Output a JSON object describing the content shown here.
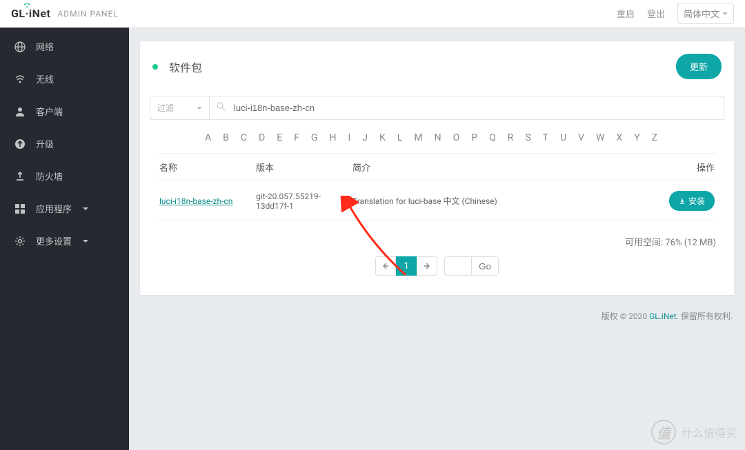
{
  "header": {
    "brand_prefix": "GL",
    "brand_suffix": "iNet",
    "panel_label": "ADMIN PANEL",
    "reboot": "重启",
    "logout": "登出",
    "lang": "简体中文"
  },
  "sidebar": {
    "items": [
      {
        "icon": "globe",
        "label": "网络"
      },
      {
        "icon": "wifi",
        "label": "无线"
      },
      {
        "icon": "user",
        "label": "客户端"
      },
      {
        "icon": "arrow-up-circle",
        "label": "升级"
      },
      {
        "icon": "upload",
        "label": "防火墙"
      },
      {
        "icon": "grid",
        "label": "应用程序",
        "dropdown": true
      },
      {
        "icon": "gear",
        "label": "更多设置",
        "dropdown": true
      }
    ]
  },
  "page": {
    "title": "软件包",
    "update_btn": "更新",
    "filter_placeholder": "过滤",
    "search_value": "luci-i18n-base-zh-cn",
    "alphabet": [
      "A",
      "B",
      "C",
      "D",
      "E",
      "F",
      "G",
      "H",
      "I",
      "J",
      "K",
      "L",
      "M",
      "N",
      "O",
      "P",
      "Q",
      "R",
      "S",
      "T",
      "U",
      "V",
      "W",
      "X",
      "Y",
      "Z"
    ],
    "table": {
      "headers": {
        "name": "名称",
        "version": "版本",
        "desc": "简介",
        "action": "操作"
      },
      "rows": [
        {
          "name": "luci-i18n-base-zh-cn",
          "version": "git-20.057.55219-13dd17f-1",
          "desc": "Translation for luci-base 中文 (Chinese)",
          "install_label": "安装"
        }
      ]
    },
    "space_label": "可用空间:",
    "space_value": "76% (12 MB)",
    "pager": {
      "current": "1",
      "go": "Go"
    }
  },
  "footer": {
    "copyright_prefix": "版权 © 2020 ",
    "link_text": "GL.iNet",
    "copyright_suffix": ". 保留所有权利."
  },
  "watermark": {
    "char": "值",
    "text": "什么值得买"
  }
}
